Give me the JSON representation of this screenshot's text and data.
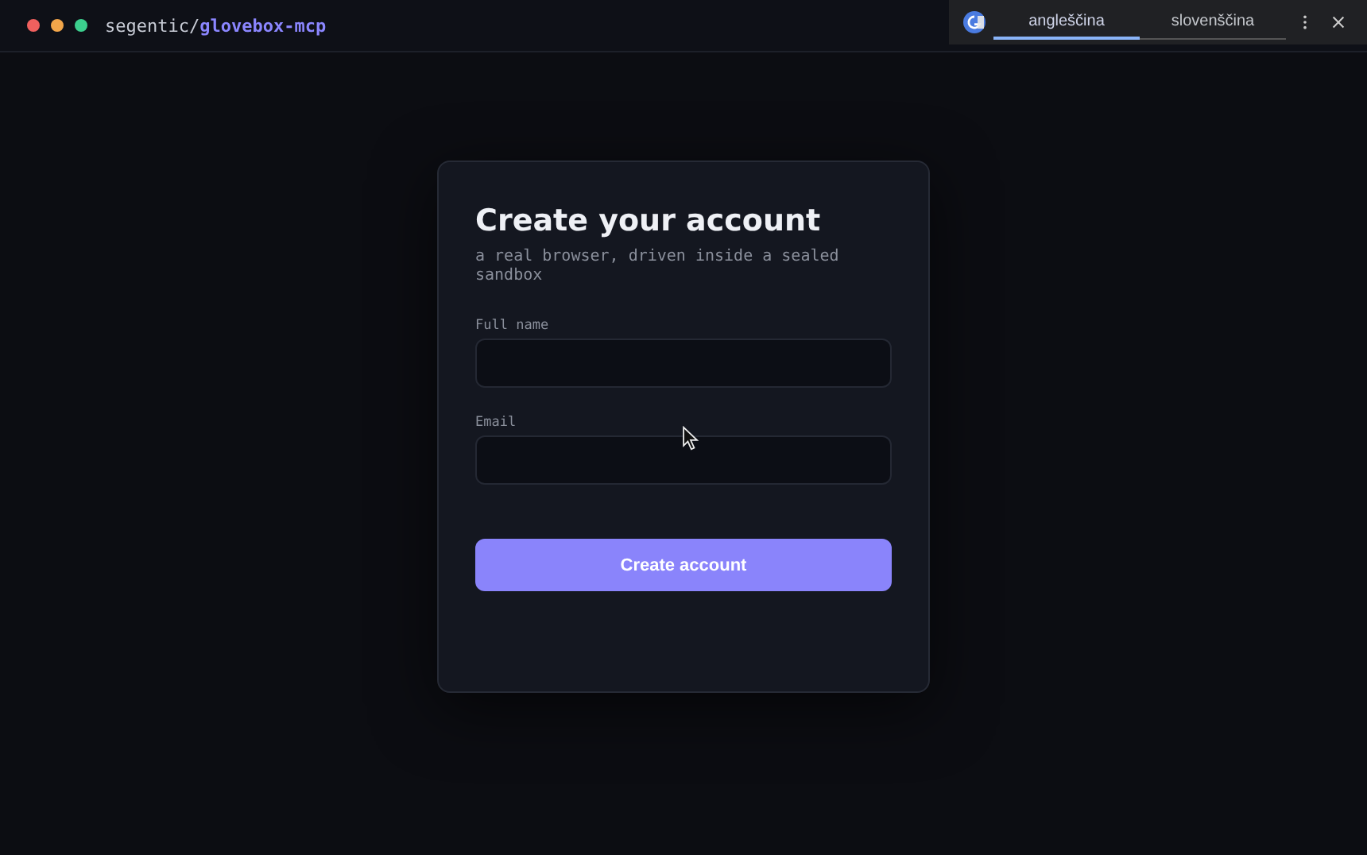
{
  "header": {
    "owner": "segentic/",
    "repo": "glovebox-mcp"
  },
  "translate_bar": {
    "tabs": [
      {
        "label": "angleščina",
        "selected": true
      },
      {
        "label": "slovenščina",
        "selected": false
      }
    ]
  },
  "form": {
    "title": "Create your account",
    "subtitle": "a real browser, driven inside a sealed sandbox",
    "fields": [
      {
        "label": "Full name"
      },
      {
        "label": "Email"
      }
    ],
    "submit": "Create account"
  }
}
